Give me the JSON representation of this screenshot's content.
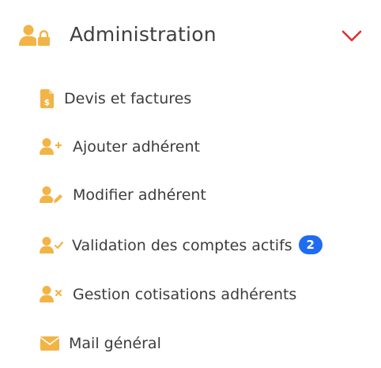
{
  "colors": {
    "icon_accent": "#f2b446",
    "chevron": "#d9342b",
    "badge_bg": "#1f6cf0",
    "text": "#3c3c3c"
  },
  "section": {
    "title": "Administration",
    "icon": "user-lock-icon",
    "expanded": true,
    "toggle_icon": "chevron-down-icon"
  },
  "items": [
    {
      "label": "Devis et factures",
      "icon": "invoice-dollar-icon"
    },
    {
      "label": "Ajouter adhérent",
      "icon": "user-plus-icon"
    },
    {
      "label": "Modifier adhérent",
      "icon": "user-edit-icon"
    },
    {
      "label": "Validation des comptes actifs",
      "icon": "user-check-icon",
      "badge": "2"
    },
    {
      "label": "Gestion cotisations adhérents",
      "icon": "user-times-icon"
    },
    {
      "label": "Mail général",
      "icon": "envelope-icon"
    }
  ]
}
